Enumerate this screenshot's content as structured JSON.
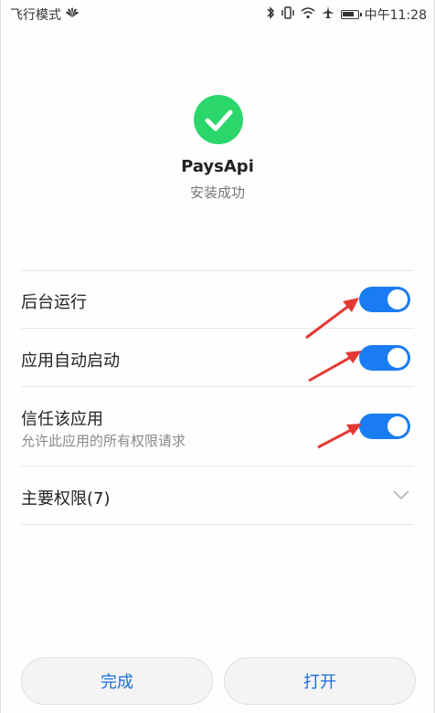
{
  "status_bar": {
    "left_text": "飞行模式",
    "time_text": "中午11:28",
    "icons": [
      "huawei-logo-icon",
      "bluetooth-icon",
      "vibrate-icon",
      "wifi-icon",
      "airplane-icon",
      "battery-icon"
    ]
  },
  "app": {
    "name": "PaysApi",
    "status": "安装成功"
  },
  "settings": [
    {
      "label": "后台运行",
      "enabled": true
    },
    {
      "label": "应用自动启动",
      "enabled": true
    },
    {
      "label": "信任该应用",
      "sublabel": "允许此应用的所有权限请求",
      "enabled": true
    }
  ],
  "permissions": {
    "label": "主要权限(7)"
  },
  "buttons": {
    "done": "完成",
    "open": "打开"
  },
  "colors": {
    "accent": "#1a7cf2",
    "success": "#2bd66b",
    "annotation_arrow": "#e53935"
  }
}
